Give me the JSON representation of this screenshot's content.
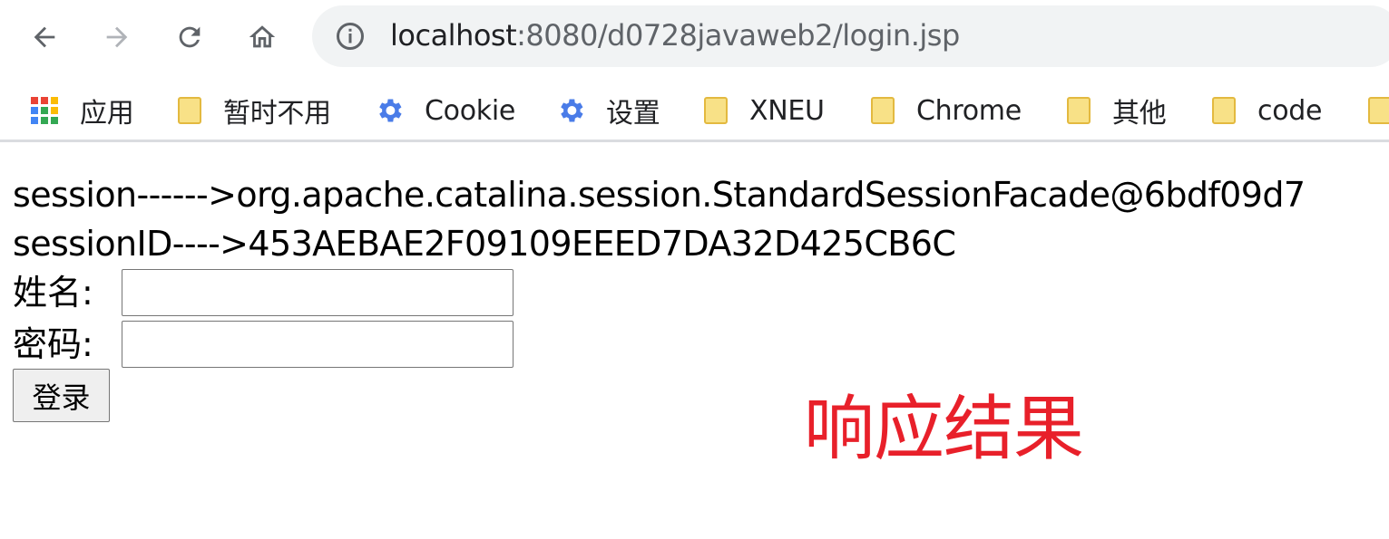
{
  "browser": {
    "url_host": "localhost",
    "url_rest": ":8080/d0728javaweb2/login.jsp",
    "nav_icons": [
      "back-icon",
      "forward-icon",
      "reload-icon",
      "home-icon"
    ]
  },
  "bookmarks": [
    {
      "label": "应用",
      "icon": "apps-grid-icon"
    },
    {
      "label": "暂时不用",
      "icon": "folder-icon"
    },
    {
      "label": "Cookie",
      "icon": "gear-icon"
    },
    {
      "label": "设置",
      "icon": "gear-icon"
    },
    {
      "label": "XNEU",
      "icon": "folder-icon"
    },
    {
      "label": "Chrome",
      "icon": "folder-icon"
    },
    {
      "label": "其他",
      "icon": "folder-icon"
    },
    {
      "label": "code",
      "icon": "folder-icon"
    }
  ],
  "page": {
    "session_line": "session------>org.apache.catalina.session.StandardSessionFacade@6bdf09d7",
    "session_id_line": "sessionID---->453AEBAE2F09109EEED7DA32D425CB6C",
    "name_label": "姓名:",
    "name_value": "",
    "password_label": "密码:",
    "password_value": "",
    "login_button": "登录"
  },
  "annotation": "响应结果",
  "colors": {
    "annotation": "#e8202a",
    "folder_fill": "#f8e187",
    "gear": "#4a7ce8",
    "omnibox": "#f1f3f4"
  }
}
